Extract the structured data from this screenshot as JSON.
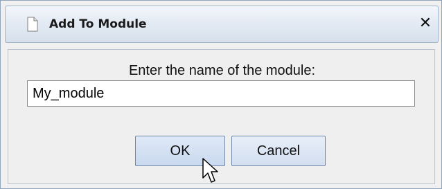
{
  "dialog": {
    "title": "Add To Module",
    "close_glyph": "✕",
    "prompt": "Enter the name of the module:",
    "input_value": "My_module",
    "ok_label": "OK",
    "cancel_label": "Cancel"
  },
  "icons": {
    "title_icon": "document-icon",
    "close_icon": "close-icon",
    "cursor_icon": "mouse-pointer-icon"
  },
  "colors": {
    "titlebar_top": "#f3f6fb",
    "titlebar_bottom": "#d6e0ec",
    "button_fill": "#c9d9ef",
    "border": "#8fa3bd"
  }
}
